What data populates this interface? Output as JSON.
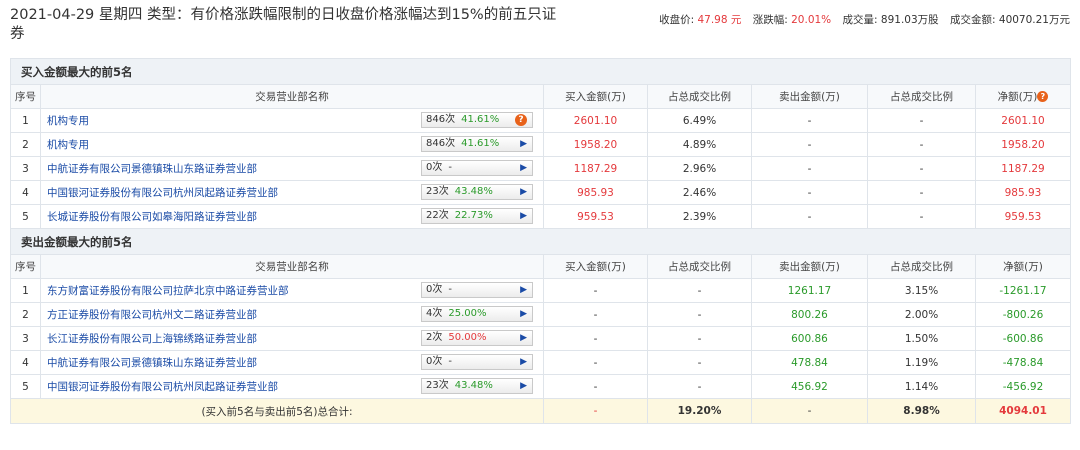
{
  "header": {
    "title": "2021-04-29 星期四  类型：有价格涨跌幅限制的日收盘价格涨幅达到15%的前五只证券",
    "close_label": "收盘价:",
    "close_value": "47.98 元",
    "change_label": "涨跌幅:",
    "change_value": "20.01%",
    "volume_label": "成交量:",
    "volume_value": "891.03万股",
    "amount_label": "成交金额:",
    "amount_value": "40070.21万元"
  },
  "columns": {
    "seq": "序号",
    "name": "交易营业部名称",
    "buy": "买入金额(万)",
    "buy_ratio": "占总成交比例",
    "sell": "卖出金额(万)",
    "sell_ratio": "占总成交比例",
    "net": "净额(万)"
  },
  "buy_section": {
    "title": "买入金额最大的前5名",
    "rows": [
      {
        "seq": "1",
        "name": "机构专用",
        "times": "846次",
        "rate": "41.61%",
        "rate_color": "green",
        "icon": "question-icon",
        "buy": "2601.10",
        "buy_ratio": "6.49%",
        "sell": "-",
        "sell_ratio": "-",
        "net": "2601.10"
      },
      {
        "seq": "2",
        "name": "机构专用",
        "times": "846次",
        "rate": "41.61%",
        "rate_color": "green",
        "icon": "arrow-icon",
        "buy": "1958.20",
        "buy_ratio": "4.89%",
        "sell": "-",
        "sell_ratio": "-",
        "net": "1958.20"
      },
      {
        "seq": "3",
        "name": "中航证券有限公司景德镇珠山东路证券营业部",
        "times": "0次",
        "rate": "-",
        "rate_color": "",
        "icon": "arrow-icon",
        "buy": "1187.29",
        "buy_ratio": "2.96%",
        "sell": "-",
        "sell_ratio": "-",
        "net": "1187.29"
      },
      {
        "seq": "4",
        "name": "中国银河证券股份有限公司杭州凤起路证券营业部",
        "times": "23次",
        "rate": "43.48%",
        "rate_color": "green",
        "icon": "arrow-icon",
        "buy": "985.93",
        "buy_ratio": "2.46%",
        "sell": "-",
        "sell_ratio": "-",
        "net": "985.93"
      },
      {
        "seq": "5",
        "name": "长城证券股份有限公司如皋海阳路证券营业部",
        "times": "22次",
        "rate": "22.73%",
        "rate_color": "green",
        "icon": "arrow-icon",
        "buy": "959.53",
        "buy_ratio": "2.39%",
        "sell": "-",
        "sell_ratio": "-",
        "net": "959.53"
      }
    ]
  },
  "sell_section": {
    "title": "卖出金额最大的前5名",
    "rows": [
      {
        "seq": "1",
        "name": "东方财富证券股份有限公司拉萨北京中路证券营业部",
        "times": "0次",
        "rate": "-",
        "rate_color": "",
        "icon": "arrow-icon",
        "buy": "-",
        "buy_ratio": "-",
        "sell": "1261.17",
        "sell_ratio": "3.15%",
        "net": "-1261.17"
      },
      {
        "seq": "2",
        "name": "方正证券股份有限公司杭州文二路证券营业部",
        "times": "4次",
        "rate": "25.00%",
        "rate_color": "green",
        "icon": "arrow-icon",
        "buy": "-",
        "buy_ratio": "-",
        "sell": "800.26",
        "sell_ratio": "2.00%",
        "net": "-800.26"
      },
      {
        "seq": "3",
        "name": "长江证券股份有限公司上海锦绣路证券营业部",
        "times": "2次",
        "rate": "50.00%",
        "rate_color": "red",
        "icon": "arrow-icon",
        "buy": "-",
        "buy_ratio": "-",
        "sell": "600.86",
        "sell_ratio": "1.50%",
        "net": "-600.86"
      },
      {
        "seq": "4",
        "name": "中航证券有限公司景德镇珠山东路证券营业部",
        "times": "0次",
        "rate": "-",
        "rate_color": "",
        "icon": "arrow-icon",
        "buy": "-",
        "buy_ratio": "-",
        "sell": "478.84",
        "sell_ratio": "1.19%",
        "net": "-478.84"
      },
      {
        "seq": "5",
        "name": "中国银河证券股份有限公司杭州凤起路证券营业部",
        "times": "23次",
        "rate": "43.48%",
        "rate_color": "green",
        "icon": "arrow-icon",
        "buy": "-",
        "buy_ratio": "-",
        "sell": "456.92",
        "sell_ratio": "1.14%",
        "net": "-456.92"
      }
    ]
  },
  "total": {
    "label": "(买入前5名与卖出前5名)总合计:",
    "buy": "-",
    "buy_ratio": "19.20%",
    "sell": "-",
    "sell_ratio": "8.98%",
    "net": "4094.01"
  },
  "colors": {
    "up": "#e4393c",
    "down": "#2a9a2a",
    "link": "#1a4ba6"
  }
}
